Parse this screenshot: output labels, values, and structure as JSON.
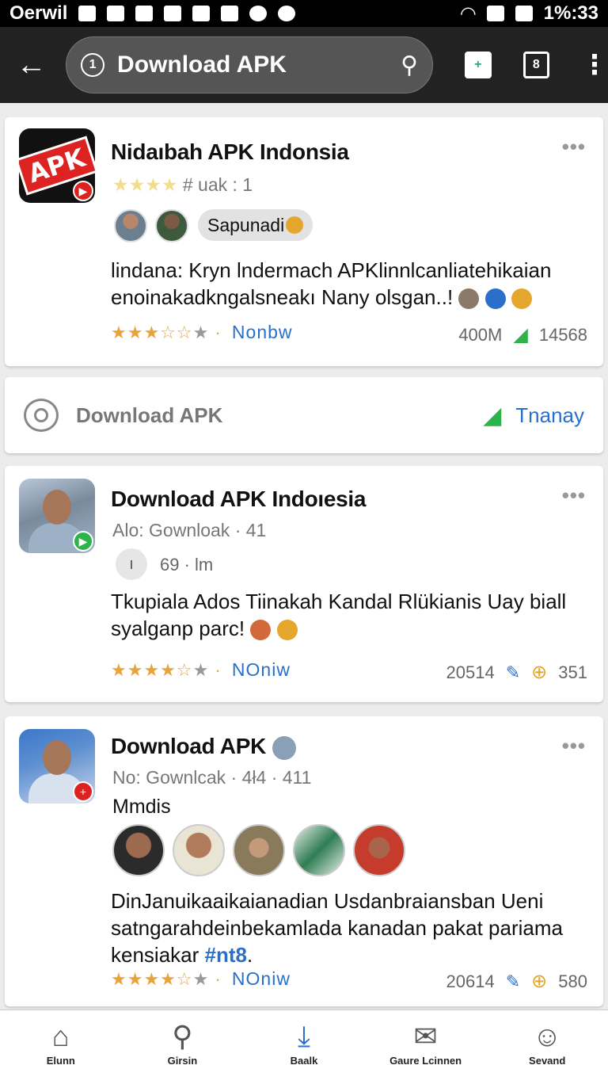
{
  "status_bar": {
    "left_text": "Oerwil",
    "time": "1%:33"
  },
  "app_bar": {
    "search_text": "Download APK"
  },
  "card1": {
    "title": "Nidaıbah APK Indonsia",
    "sub": "# uak : 1",
    "tag": "Sapunadi",
    "desc": "lindana: Kryn lndermach APKlinnlcanliatehikaian enoinakadkngalsneakı Nany olsgan..!",
    "link": "Nonbw",
    "stat1": "400M",
    "stat2": "14568"
  },
  "search_card": {
    "label": "Download APK",
    "trend_label": "Tnanay"
  },
  "card2": {
    "title": "Download APK Indoıesia",
    "sub": "Alo: Gownloak · 41",
    "meta": "69 · lm",
    "desc": "Tkupiala Ados Tiinakah Kandal Rlükianis Uay biall syalganp parc!",
    "link": "NOniw",
    "stat1": "20514",
    "stat2": "351"
  },
  "card3": {
    "title": "Download APK",
    "sub": "No: Gownlcak · 4ł4 · 411",
    "label": "Mmdis",
    "desc": "DinJanuikaaikaianadian Usdanbraiansban Ueni satngarahdeinbekamlada kanadan pakat pariama kensiakar",
    "hashtag": "#nt8",
    "link": "NOniw",
    "stat1": "20614",
    "stat2": "580"
  },
  "bottom_nav": [
    {
      "label": "Elunn",
      "icon": "home-icon"
    },
    {
      "label": "Girsin",
      "icon": "search-icon"
    },
    {
      "label": "Baalk",
      "icon": "download-icon"
    },
    {
      "label": "Gaure Lcinnen",
      "icon": "mail-icon"
    },
    {
      "label": "Sevand",
      "icon": "profile-icon"
    }
  ],
  "colors": {
    "accent": "#2a6fc9",
    "star": "#e8a33a",
    "bar": "#222222",
    "apk_red": "#d22222"
  }
}
